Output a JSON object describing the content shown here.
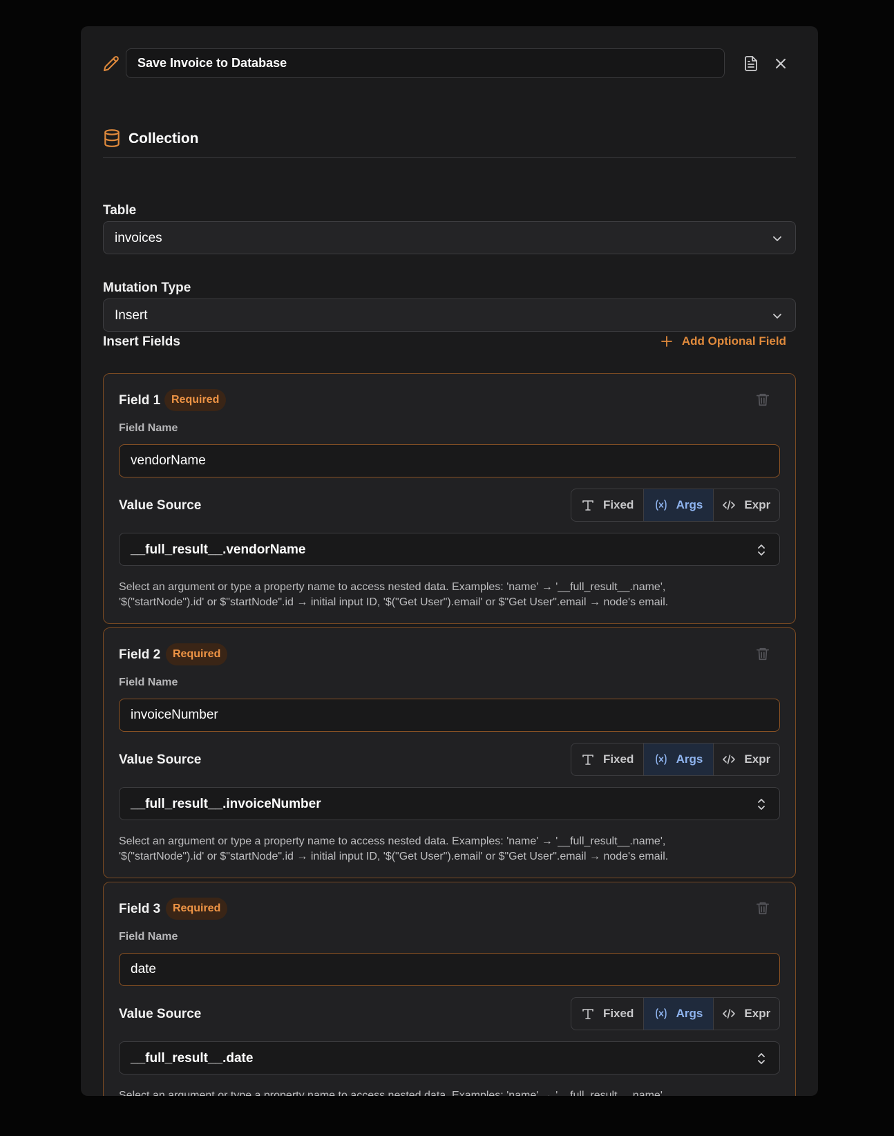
{
  "header": {
    "title_value": "Save Invoice to Database",
    "icons": [
      "pencil-icon",
      "document-icon",
      "close-icon"
    ]
  },
  "section": {
    "title": "Collection",
    "icon": "database-icon"
  },
  "table": {
    "label": "Table",
    "value": "invoices"
  },
  "mutation": {
    "label": "Mutation Type",
    "value": "Insert"
  },
  "insert_fields": {
    "title": "Insert Fields",
    "add_label": "Add Optional Field"
  },
  "field_common": {
    "required_badge": "Required",
    "field_name_label": "Field Name",
    "value_source_label": "Value Source",
    "source_options": [
      "Fixed",
      "Args",
      "Expr"
    ],
    "selected_option": "Args",
    "help_line1": "Select an argument or type a property name to access nested data. Examples: 'name' → '__full_result__.name',",
    "help_line2": "'$(\"startNode\").id' or $\"startNode\".id → initial input ID, '$(\"Get User\").email' or $\"Get User\".email → node's email."
  },
  "fields": [
    {
      "title": "Field 1",
      "name": "vendorName",
      "source": "__full_result__.vendorName"
    },
    {
      "title": "Field 2",
      "name": "invoiceNumber",
      "source": "__full_result__.invoiceNumber"
    },
    {
      "title": "Field 3",
      "name": "date",
      "source": "__full_result__.date"
    }
  ],
  "colors": {
    "accent_orange": "#e08a3c",
    "panel_bg": "#1b1b1c",
    "selected_blue": "#8fb4ef"
  }
}
